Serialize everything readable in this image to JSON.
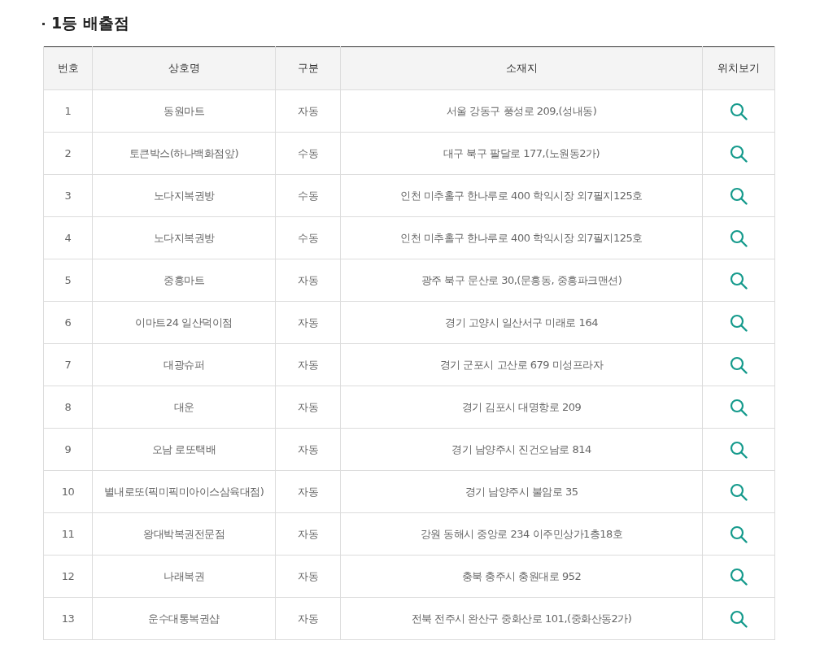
{
  "section_title": "1등 배출점",
  "table": {
    "columns": [
      "번호",
      "상호명",
      "구분",
      "소재지",
      "위치보기"
    ],
    "rows": [
      {
        "no": "1",
        "name": "동원마트",
        "type": "자동",
        "address": "서울 강동구 풍성로 209,(성내동)"
      },
      {
        "no": "2",
        "name": "토큰박스(하나백화점앞)",
        "type": "수동",
        "address": "대구 북구 팔달로 177,(노원동2가)"
      },
      {
        "no": "3",
        "name": "노다지복권방",
        "type": "수동",
        "address": "인천 미추홀구 한나루로 400 학익시장 외7필지125호"
      },
      {
        "no": "4",
        "name": "노다지복권방",
        "type": "수동",
        "address": "인천 미추홀구 한나루로 400 학익시장 외7필지125호"
      },
      {
        "no": "5",
        "name": "중흥마트",
        "type": "자동",
        "address": "광주 북구 문산로 30,(문흥동, 중흥파크맨션)"
      },
      {
        "no": "6",
        "name": "이마트24 일산덕이점",
        "type": "자동",
        "address": "경기 고양시 일산서구 미래로 164"
      },
      {
        "no": "7",
        "name": "대광슈퍼",
        "type": "자동",
        "address": "경기 군포시 고산로 679 미성프라자"
      },
      {
        "no": "8",
        "name": "대운",
        "type": "자동",
        "address": "경기 김포시 대명항로 209"
      },
      {
        "no": "9",
        "name": "오남 로또택배",
        "type": "자동",
        "address": "경기 남양주시 진건오남로 814"
      },
      {
        "no": "10",
        "name": "별내로또(픽미픽미아이스삼육대점)",
        "type": "자동",
        "address": "경기 남양주시 불암로 35"
      },
      {
        "no": "11",
        "name": "왕대박복권전문점",
        "type": "자동",
        "address": "강원 동해시 중앙로 234 이주민상가1층18호"
      },
      {
        "no": "12",
        "name": "나래복권",
        "type": "자동",
        "address": "충북 충주시 충원대로 952"
      },
      {
        "no": "13",
        "name": "운수대통복권샵",
        "type": "자동",
        "address": "전북 전주시 완산구 중화산로 101,(중화산동2가)"
      }
    ]
  }
}
